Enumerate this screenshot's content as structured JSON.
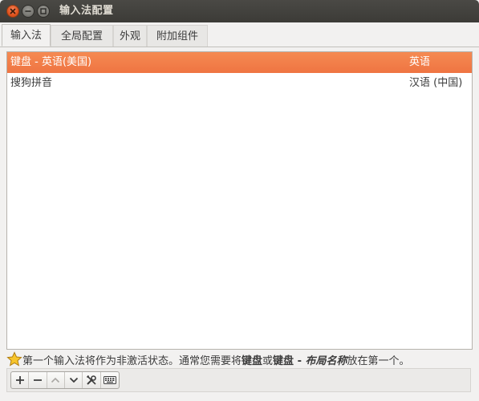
{
  "window": {
    "title": "输入法配置"
  },
  "tabs": [
    {
      "label": "输入法",
      "active": true
    },
    {
      "label": "全局配置",
      "active": false
    },
    {
      "label": "外观",
      "active": false
    },
    {
      "label": "附加组件",
      "active": false
    }
  ],
  "input_methods": [
    {
      "name": "键盘 - 英语(美国)",
      "language": "英语",
      "selected": true
    },
    {
      "name": "搜狗拼音",
      "language": "汉语 (中国)",
      "selected": false
    }
  ],
  "hint": {
    "icon": "star-icon",
    "part1": "第一个输入法将作为非激活状态。通常您需要将",
    "bold1": "键盘",
    "part2": "或",
    "bold2": "键盘 - ",
    "bold_italic": "布局名称",
    "part3": "放在第一个。"
  },
  "toolbar": {
    "buttons": [
      "add-icon",
      "remove-icon",
      "move-up-icon",
      "move-down-icon",
      "configure-icon",
      "keyboard-icon"
    ]
  },
  "colors": {
    "selection": "#f07746",
    "titlebar": "#3c3b37",
    "close_button": "#e0531e"
  }
}
